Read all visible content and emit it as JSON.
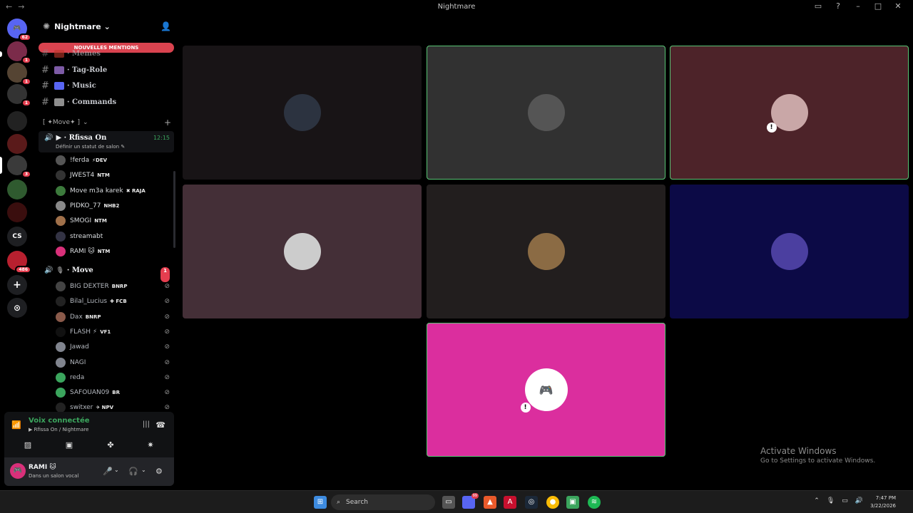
{
  "window": {
    "title": "Nightmare",
    "nav_back": "←",
    "nav_forward": "→",
    "controls": [
      "▭",
      "?",
      "–",
      "□",
      "✕"
    ]
  },
  "rail": {
    "servers": [
      {
        "label": "",
        "color": "#5865f2",
        "badge": "62"
      },
      {
        "label": "",
        "color": "#7b2b4a",
        "badge": "1"
      },
      {
        "label": "",
        "color": "#554433",
        "badge": "1"
      },
      {
        "label": "",
        "color": "#333",
        "badge": "1"
      },
      {
        "label": "",
        "color": "#222",
        "badge": ""
      },
      {
        "label": "",
        "color": "#5a1a1a",
        "badge": ""
      },
      {
        "label": "",
        "color": "#3a3a3a",
        "badge": "3"
      },
      {
        "label": "",
        "color": "#2f5a2f",
        "badge": ""
      },
      {
        "label": "",
        "color": "#3a0e0e",
        "badge": ""
      },
      {
        "label": "CS",
        "color": "#1e1f22",
        "badge": ""
      },
      {
        "label": "",
        "color": "#b8202f",
        "badge": "486"
      }
    ],
    "add_label": "+",
    "explore_label": "⊙"
  },
  "sidebar": {
    "server_name": "Nightmare ⌄",
    "mentions_label": "NOUVELLES MENTIONS",
    "text_channels": [
      {
        "name": "· Memes",
        "color": "#c0392b"
      },
      {
        "name": "· Tag-Role",
        "color": "#7d5ba6"
      },
      {
        "name": "· Music",
        "color": "#5865f2"
      },
      {
        "name": "· Commands",
        "color": "#8e8e8e"
      }
    ],
    "category": "[ ✦Move✦ ]",
    "category_chevron": "⌄",
    "voice_active": {
      "name": "▶ · Rfissa On",
      "status": "Définir un statut de salon ✎",
      "time": "12:15",
      "members": [
        {
          "name": "!ferda",
          "tag": "⚡DEV",
          "color": "#555"
        },
        {
          "name": "JWEST4",
          "tag": "NTM",
          "color": "#333"
        },
        {
          "name": "Move m3a karek",
          "tag": "✖ RAJA",
          "color": "#3c7a3c"
        },
        {
          "name": "PIDKO_77",
          "tag": "NHB2",
          "color": "#888"
        },
        {
          "name": "SMOGI",
          "tag": "NTM",
          "color": "#a0704a"
        },
        {
          "name": "streamabt",
          "tag": "",
          "color": "#334"
        },
        {
          "name": "RAMI 🐱",
          "tag": "NTM",
          "color": "#d9307a"
        }
      ]
    },
    "voice_move": {
      "name": "· Move",
      "badge": "1",
      "members": [
        {
          "name": "BIG DEXTER",
          "tag": "BNRP",
          "color": "#444"
        },
        {
          "name": "Bilal_Lucius",
          "tag": "✚ FCB",
          "color": "#222"
        },
        {
          "name": "Dax",
          "tag": "BNRP",
          "color": "#8a5a4a"
        },
        {
          "name": "FLASH ⚡",
          "tag": "VF1",
          "color": "#111"
        },
        {
          "name": "Jawad",
          "tag": "",
          "color": "#80848e"
        },
        {
          "name": "NAGI",
          "tag": "",
          "color": "#80848e"
        },
        {
          "name": "reda",
          "tag": "",
          "color": "#3ba55d"
        },
        {
          "name": "SAFOUAN09",
          "tag": "BR",
          "color": "#3ba55d"
        },
        {
          "name": "switxer",
          "tag": "✈ NPV",
          "color": "#222"
        }
      ]
    }
  },
  "voice_panel": {
    "title": "Voix connectée",
    "subtitle": "▶ Rfissa On / Nightmare"
  },
  "user_panel": {
    "name": "RAMI 🐱",
    "status": "Dans un salon vocal"
  },
  "watermark": {
    "line1": "Activate Windows",
    "line2": "Go to Settings to activate Windows."
  },
  "taskbar": {
    "search": "Search",
    "time": "7:47 PM",
    "date": "3/22/2026",
    "discord_badge": "99"
  },
  "tiles": [
    {
      "bg": "#181416",
      "avatar": "#2c3340",
      "speaking": false,
      "warn": false
    },
    {
      "bg": "#313131",
      "avatar": "#555",
      "speaking": true,
      "warn": false
    },
    {
      "bg": "#4d2329",
      "avatar": "#c9a7a7",
      "speaking": true,
      "warn": true
    },
    {
      "bg": "#442f37",
      "avatar": "#ccc",
      "speaking": false,
      "warn": false
    },
    {
      "bg": "#221e1e",
      "avatar": "#8b6b44",
      "speaking": false,
      "warn": false
    },
    {
      "bg": "#0c0a46",
      "avatar": "#4b3fa0",
      "speaking": false,
      "warn": false
    },
    {
      "bg": "#db2e9e",
      "avatar": "#db2e9e",
      "speaking": true,
      "warn": true
    }
  ]
}
